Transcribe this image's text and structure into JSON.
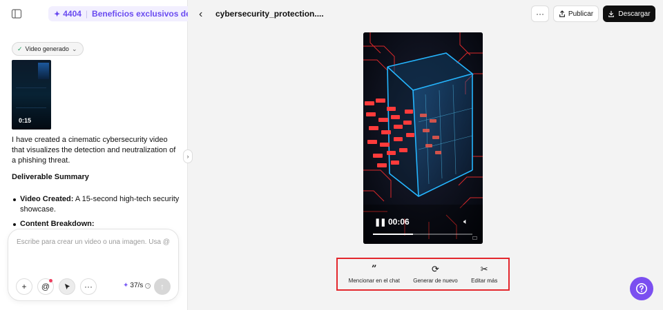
{
  "promo": {
    "count": "4404",
    "label": "Beneficios exclusivos de Seedance"
  },
  "chip": {
    "label": "Video generado"
  },
  "thumbnail": {
    "duration": "0:15"
  },
  "message": {
    "intro": "I have created a cinematic cybersecurity video that visualizes the detection and neutralization of a phishing threat.",
    "heading": "Deliverable Summary",
    "bullets": [
      {
        "title": "Video Created:",
        "text": "A 15-second high-tech security showcase."
      },
      {
        "title": "Content Breakdown:",
        "text": ""
      }
    ]
  },
  "composer": {
    "placeholder": "Escribe para crear un video o una imagen. Usa @",
    "credits": "37/s"
  },
  "header": {
    "title": "cybersecurity_protection....",
    "publish": "Publicar",
    "download": "Descargar"
  },
  "player": {
    "time": "00:06",
    "progress": 0.4
  },
  "actions": [
    {
      "label": "Mencionar en el chat",
      "icon": "quote-icon"
    },
    {
      "label": "Generar de nuevo",
      "icon": "refresh-icon"
    },
    {
      "label": "Editar más",
      "icon": "scissors-icon"
    }
  ],
  "colors": {
    "accent": "#7b4ff0",
    "promo_text": "#6a4bf0",
    "highlight": "#e3262c",
    "video_glow": "#ff3b3b",
    "cube_edge": "#25b6ff"
  }
}
